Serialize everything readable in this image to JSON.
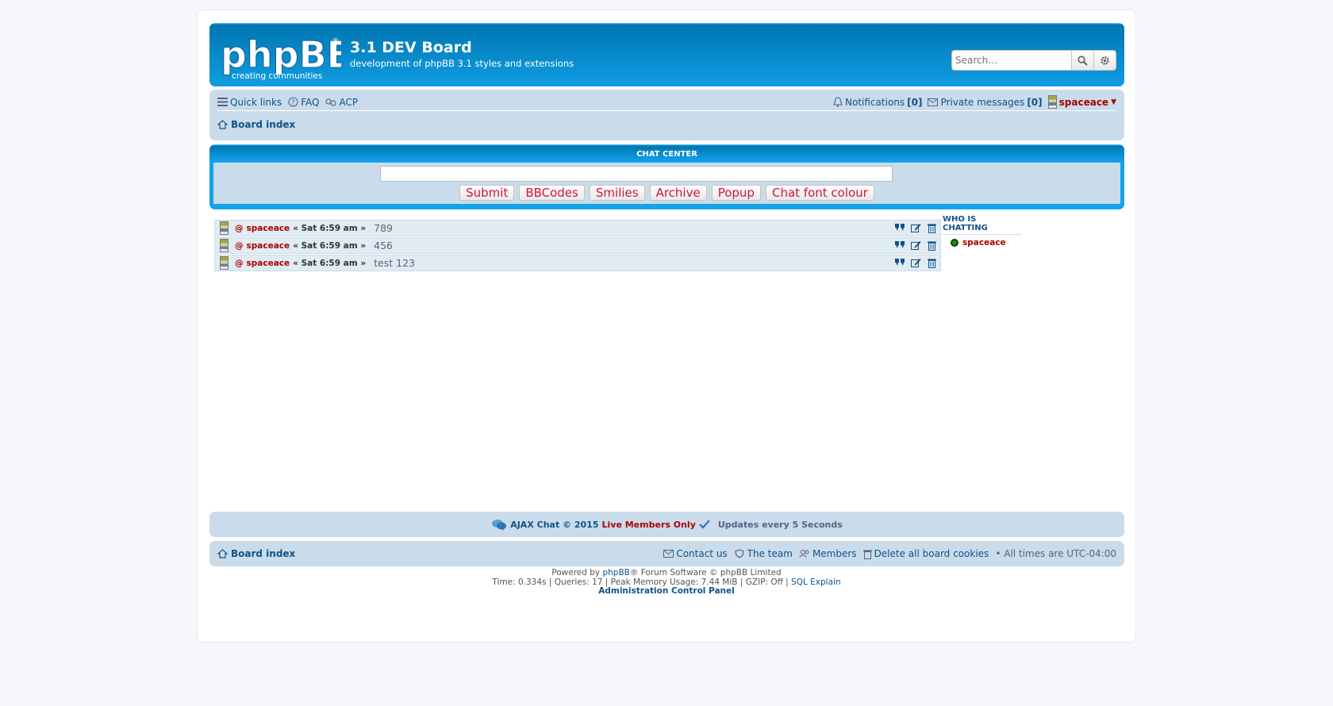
{
  "header": {
    "site_title": "3.1 DEV Board",
    "site_description": "development of phpBB 3.1 styles and extensions",
    "logo_text": "phpBB",
    "logo_tagline": "creating communities",
    "search_placeholder": "Search…"
  },
  "navbar": {
    "quick_links": "Quick links",
    "faq": "FAQ",
    "acp": "ACP",
    "notifications_label": "Notifications",
    "notifications_count": "[0]",
    "pm_label": "Private messages",
    "pm_count": "[0]",
    "username": "spaceace",
    "board_index": "Board index"
  },
  "chat": {
    "title": "CHAT CENTER",
    "buttons": {
      "submit": "Submit",
      "bbcodes": "BBCodes",
      "smilies": "Smilies",
      "archive": "Archive",
      "popup": "Popup",
      "font_colour": "Chat font colour"
    },
    "messages": [
      {
        "at": "@",
        "user": "spaceace",
        "time": "« Sat 6:59 am »",
        "text": "789"
      },
      {
        "at": "@",
        "user": "spaceace",
        "time": "« Sat 6:59 am »",
        "text": "456"
      },
      {
        "at": "@",
        "user": "spaceace",
        "time": "« Sat 6:59 am »",
        "text": "test 123"
      }
    ],
    "who_title": "WHO IS CHATTING",
    "who_users": [
      "spaceace"
    ]
  },
  "status": {
    "copyright": "AJAX Chat © 2015",
    "live": "Live Members Only",
    "updates": "Updates every 5 Seconds"
  },
  "footer": {
    "board_index": "Board index",
    "contact": "Contact us",
    "team": "The team",
    "members": "Members",
    "delete_cookies": "Delete all board cookies",
    "timezone": "• All times are UTC-04:00",
    "powered_prefix": "Powered by",
    "powered_link": "phpBB",
    "powered_suffix": "® Forum Software © phpBB Limited",
    "debug": "Time: 0.334s | Queries: 17 | Peak Memory Usage: 7.44 MiB | GZIP: Off |",
    "sql_explain": "SQL Explain",
    "acp_link": "Administration Control Panel"
  },
  "colors": {
    "header_blue": "#12a3eb",
    "nav_bg": "#cadceb",
    "username_red": "#aa0000",
    "link_blue": "#105289",
    "button_red": "#d31141"
  }
}
